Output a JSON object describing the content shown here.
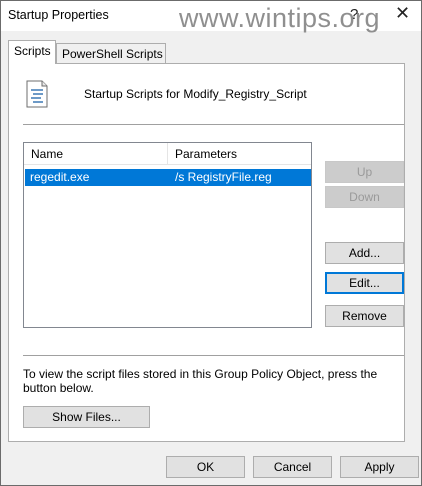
{
  "window": {
    "title": "Startup Properties",
    "watermark": "www.wintips.org",
    "help_glyph": "?",
    "close_glyph": "✕"
  },
  "tabs": [
    {
      "label": "Scripts",
      "active": true
    },
    {
      "label": "PowerShell Scripts",
      "active": false
    }
  ],
  "panel": {
    "header_label": "Startup Scripts for Modify_Registry_Script",
    "icon": "script-file-icon",
    "list": {
      "columns": [
        "Name",
        "Parameters"
      ],
      "rows": [
        {
          "name": "regedit.exe",
          "parameters": "/s RegistryFile.reg",
          "selected": true
        }
      ]
    },
    "buttons": {
      "up": "Up",
      "down": "Down",
      "add": "Add...",
      "edit": "Edit...",
      "remove": "Remove"
    },
    "info_text": "To view the script files stored in this Group Policy Object, press the button below.",
    "show_files": "Show Files..."
  },
  "footer": {
    "ok": "OK",
    "cancel": "Cancel",
    "apply": "Apply"
  },
  "colors": {
    "selection": "#0078d7",
    "dialog_bg": "#f0f0f0",
    "button_bg": "#e1e1e1"
  }
}
